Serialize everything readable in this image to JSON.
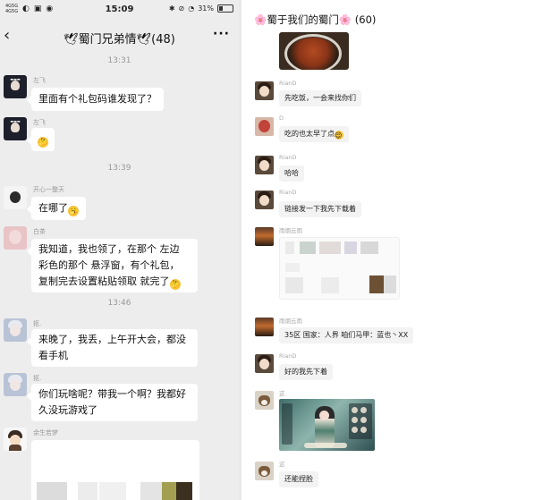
{
  "left_phone": {
    "status_bar": {
      "signal_text": "4G5G\n4G5G",
      "time": "15:09",
      "battery_text": "31%",
      "battery_level": 0.31
    },
    "header": {
      "back_icon": "chevron-left",
      "title": "🕊蜀门兄弟情🕊(48)",
      "more_icon": "ellipsis"
    },
    "timestamps": [
      "13:31",
      "13:39",
      "13:46"
    ],
    "messages": [
      {
        "sender": "左飞",
        "text": "里面有个礼包码谁发现了？",
        "avatar": "anime-dark"
      },
      {
        "sender": "左飞",
        "text": "",
        "emoji": "🤔",
        "avatar": "anime-dark"
      },
      {
        "sender": "开心一整天",
        "text": "在哪了",
        "emoji": "🥱",
        "avatar": "bw-person"
      },
      {
        "sender": "白茶",
        "lines": [
          "我知道，我也领了，在那个 左边",
          "彩色的那个 悬浮窗，有个礼包，",
          "复制完去设置粘贴领取 就完了"
        ],
        "emoji": "🤔",
        "avatar": "pink-flower"
      },
      {
        "sender": "抠.",
        "lines": [
          "来晚了，我丢，上午开大会，都没",
          "看手机"
        ],
        "avatar": "white-hair"
      },
      {
        "sender": "抠.",
        "lines": [
          "你们玩啥呢？带我一个啊？我都好",
          "久没玩游戏了"
        ],
        "avatar": "white-hair"
      },
      {
        "sender": "余生若梦",
        "text": "",
        "avatar": "cartoon-boy"
      }
    ]
  },
  "right_desktop": {
    "title": "🌸蜀于我们的蜀门🌸 (60)",
    "messages": [
      {
        "sender": "RianD",
        "text": "先吃饭，一会来找你们",
        "avatar": "girl"
      },
      {
        "sender": "D",
        "text": "吃的也太早了点",
        "emoji": "😌",
        "avatar": "red"
      },
      {
        "sender": "RianD",
        "text": "哈哈",
        "avatar": "girl"
      },
      {
        "sender": "RianD",
        "text": "链接发一下我先下载着",
        "avatar": "girl"
      },
      {
        "sender": "雨烟云雨",
        "text": "",
        "avatar": "sunset"
      },
      {
        "sender": "雨烟云雨",
        "text": "35区 国家：人界 咱们马甲：蓝也丶XX",
        "avatar": "sunset"
      },
      {
        "sender": "RianD",
        "text": "好的我先下着",
        "avatar": "girl"
      },
      {
        "sender": "这",
        "text": "",
        "avatar": "dog"
      },
      {
        "sender": "这",
        "text": "还能捏脸",
        "avatar": "dog"
      }
    ]
  },
  "colors": {
    "left_bg": "#ededed",
    "bubble": "#ffffff",
    "right_bubble": "#f3f3f3",
    "accent_flower": "#e77a9c"
  }
}
